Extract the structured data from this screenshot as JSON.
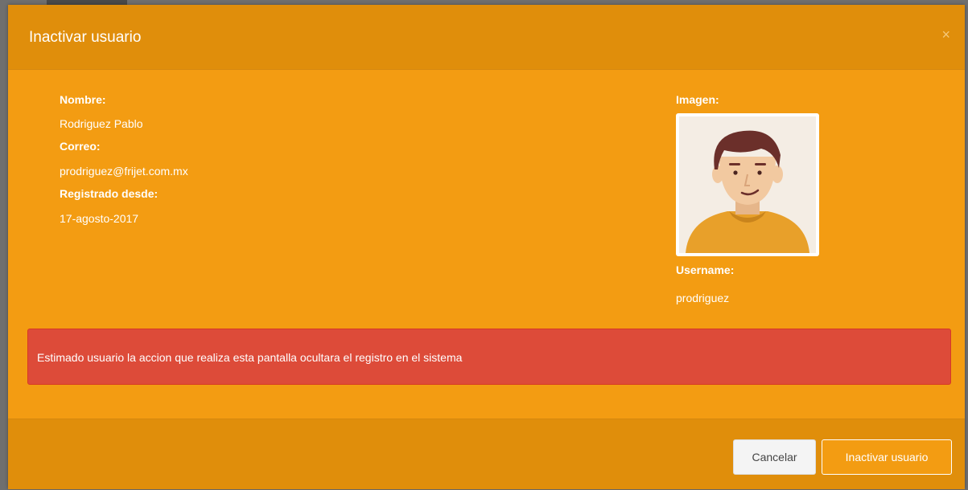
{
  "modal": {
    "title": "Inactivar usuario",
    "close_label": "×"
  },
  "user": {
    "name_label": "Nombre:",
    "name": "Rodriguez Pablo",
    "email_label": "Correo:",
    "email": "prodriguez@frijet.com.mx",
    "registered_label": "Registrado desde:",
    "registered": "17-agosto-2017",
    "image_label": "Imagen:",
    "username_label": "Username:",
    "username": "prodriguez"
  },
  "alert": {
    "message": "Estimado usuario la accion que realiza esta pantalla ocultara el registro en el sistema"
  },
  "footer": {
    "cancel_label": "Cancelar",
    "confirm_label": "Inactivar usuario"
  },
  "colors": {
    "modal_bg": "#f39c12",
    "header_bg": "#e08e0b",
    "alert_bg": "#dd4b39",
    "avatar_bg": "#f4ede4",
    "avatar_hair": "#6b2f2a",
    "avatar_skin": "#f2c9a0",
    "avatar_shirt": "#e8a02a"
  }
}
